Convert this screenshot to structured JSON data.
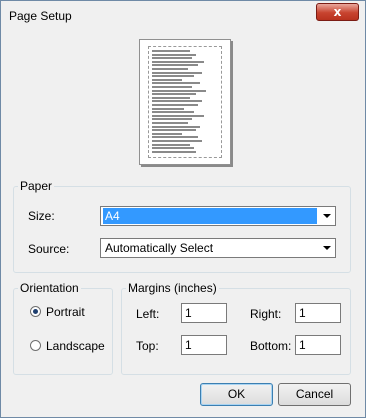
{
  "window": {
    "title": "Page Setup",
    "close_glyph": "x"
  },
  "paper": {
    "legend": "Paper",
    "size_label": "Size:",
    "size_value": "A4",
    "source_label": "Source:",
    "source_value": "Automatically Select"
  },
  "orientation": {
    "legend": "Orientation",
    "portrait_label": "Portrait",
    "landscape_label": "Landscape",
    "selected": "Portrait"
  },
  "margins": {
    "legend": "Margins (inches)",
    "left_label": "Left:",
    "left_value": "1",
    "right_label": "Right:",
    "right_value": "1",
    "top_label": "Top:",
    "top_value": "1",
    "bottom_label": "Bottom:",
    "bottom_value": "1"
  },
  "buttons": {
    "ok": "OK",
    "cancel": "Cancel"
  },
  "colors": {
    "selection": "#3399ff",
    "close_button": "#c8432f"
  }
}
